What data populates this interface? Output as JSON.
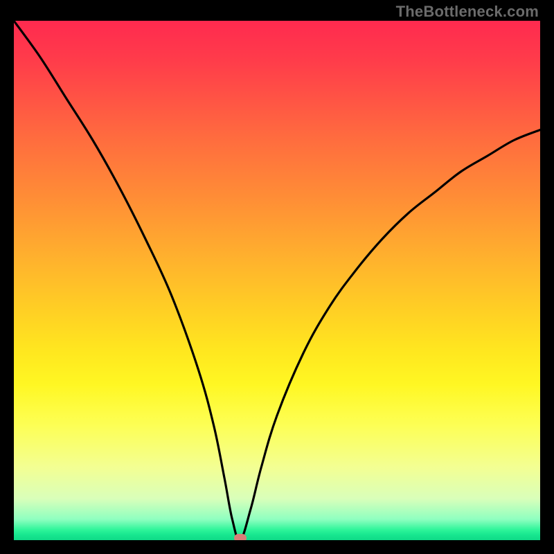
{
  "watermark": "TheBottleneck.com",
  "colors": {
    "background": "#000000",
    "curve": "#000000",
    "marker": "#d77f78",
    "gradient_top": "#ff2a4f",
    "gradient_bottom": "#0fd987"
  },
  "chart_data": {
    "type": "line",
    "title": "",
    "xlabel": "",
    "ylabel": "",
    "xlim": [
      0,
      100
    ],
    "ylim": [
      0,
      100
    ],
    "series": [
      {
        "name": "bottleneck-curve",
        "x": [
          0,
          5,
          10,
          15,
          20,
          25,
          30,
          35,
          38,
          40,
          41.5,
          43,
          45,
          47,
          50,
          55,
          60,
          65,
          70,
          75,
          80,
          85,
          90,
          95,
          100
        ],
        "y": [
          100,
          93,
          85,
          77,
          68,
          58,
          47,
          33,
          22,
          12,
          4,
          0,
          6,
          14,
          24,
          36,
          45,
          52,
          58,
          63,
          67,
          71,
          74,
          77,
          79
        ]
      }
    ],
    "marker": {
      "x": 43,
      "y": 0
    },
    "grid": false,
    "legend": false
  }
}
